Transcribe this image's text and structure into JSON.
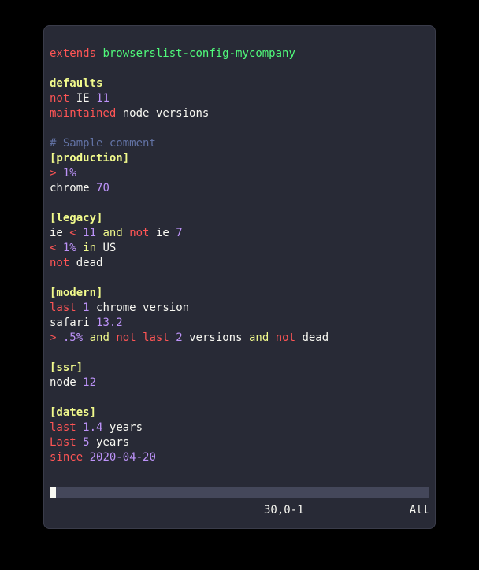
{
  "lines": {
    "l0_extends": "extends",
    "l0_pkg": "browserslist-config-mycompany",
    "l2_defaults": "defaults",
    "l3_not": "not",
    "l3_ie": "IE",
    "l3_11": "11",
    "l4_maintained": "maintained",
    "l4_node": "node",
    "l4_versions": "versions",
    "l6_comment": "# Sample comment",
    "l7_section": "[production]",
    "l8_gt": ">",
    "l8_1pct": "1%",
    "l9_chrome": "chrome",
    "l9_70": "70",
    "l11_section": "[legacy]",
    "l12_ie": "ie",
    "l12_lt": "<",
    "l12_11": "11",
    "l12_and": "and",
    "l12_not": "not",
    "l12_ie2": "ie",
    "l12_7": "7",
    "l13_lt": "<",
    "l13_1pct": "1%",
    "l13_in": "in",
    "l13_us": "US",
    "l14_not": "not",
    "l14_dead": "dead",
    "l16_section": "[modern]",
    "l17_last": "last",
    "l17_1": "1",
    "l17_chrome": "chrome",
    "l17_version": "version",
    "l18_safari": "safari",
    "l18_132": "13.2",
    "l19_gt": ">",
    "l19_05": ".5%",
    "l19_and": "and",
    "l19_not": "not",
    "l19_last": "last",
    "l19_2": "2",
    "l19_versions": "versions",
    "l19_and2": "and",
    "l19_not2": "not",
    "l19_dead": "dead",
    "l21_section": "[ssr]",
    "l22_node": "node",
    "l22_12": "12",
    "l24_section": "[dates]",
    "l25_last": "last",
    "l25_14": "1.4",
    "l25_years": "years",
    "l26_Last": "Last",
    "l26_5": "5",
    "l26_years": "years",
    "l27_since": "since",
    "l27_date": "2020-04-20"
  },
  "status": {
    "position": "30,0-1",
    "scroll": "All"
  }
}
